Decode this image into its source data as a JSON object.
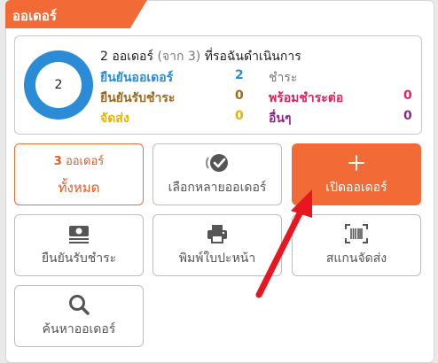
{
  "header": {
    "title": "ออเดอร์"
  },
  "summary": {
    "donut_value": "2",
    "title_main": "2 ออเดอร์",
    "title_muted": "(จาก 3)",
    "title_suffix": "ที่รอฉันดำเนินการ",
    "rows": [
      {
        "label": "ยืนยันออเดอร์",
        "value": "2",
        "color": "#2a8bd6"
      },
      {
        "label": "ยืนยันรับชำระ",
        "value": "0",
        "color": "#9a6a1e"
      },
      {
        "label": "จัดส่ง",
        "value": "0",
        "color": "#e0b400"
      },
      {
        "label": "ชำระ",
        "value": "",
        "color": "#777777"
      },
      {
        "label": "พร้อมชำระต่อ",
        "value": "0",
        "color": "#e0245e"
      },
      {
        "label": "อื่นๆ",
        "value": "0",
        "color": "#8a2a8a"
      }
    ]
  },
  "buttons": {
    "all": {
      "count": "3",
      "count_suffix": "ออเดอร์",
      "label": "ทั้งหมด"
    },
    "multi_select": {
      "label": "เลือกหลายออเดอร์",
      "icon": "check-circle-icon"
    },
    "new_order": {
      "label": "เปิดออเดอร์",
      "icon": "plus-icon"
    },
    "confirm_payment": {
      "label": "ยืนยันรับชำระ",
      "icon": "money-icon"
    },
    "print": {
      "label": "พิมพ์ใบปะหน้า",
      "icon": "printer-icon"
    },
    "scan": {
      "label": "สแกนจัดส่ง",
      "icon": "barcode-scan-icon"
    },
    "search": {
      "label": "ค้นหาออเดอร์",
      "icon": "search-icon"
    }
  },
  "colors": {
    "accent": "#f26a36",
    "donut": "#2a8bd6",
    "annotation_arrow": "#e8161e"
  }
}
